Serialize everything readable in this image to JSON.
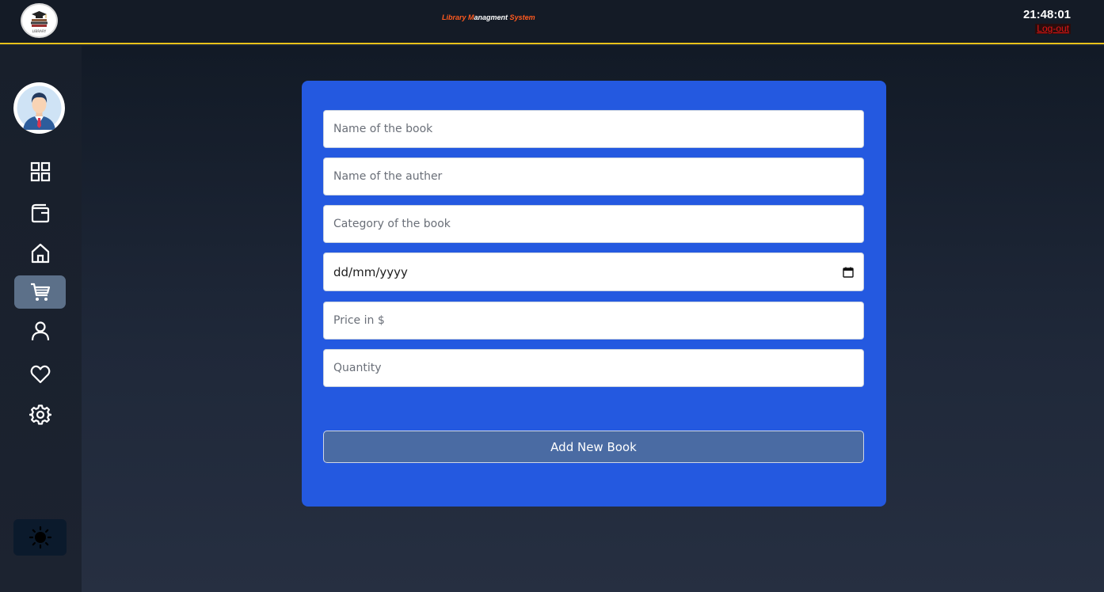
{
  "header": {
    "logo_caption": "LIBRARY",
    "title_parts": [
      "Library M",
      "a",
      "nagment ",
      "S",
      "ystem"
    ],
    "clock": "21:48:01",
    "logout_label": "Log-out"
  },
  "sidebar": {
    "items": [
      {
        "icon": "dashboard-grid-icon",
        "active": false
      },
      {
        "icon": "wallet-icon",
        "active": false
      },
      {
        "icon": "home-icon",
        "active": false
      },
      {
        "icon": "cart-icon",
        "active": true
      },
      {
        "icon": "user-icon",
        "active": false
      },
      {
        "icon": "heart-icon",
        "active": false
      },
      {
        "icon": "gear-icon",
        "active": false
      }
    ],
    "theme_toggle_icon": "sun-icon"
  },
  "form": {
    "book_name_placeholder": "Name of the book",
    "author_placeholder": "Name of the auther",
    "category_placeholder": "Category of the book",
    "date_placeholder": "dd/mm/yyyy",
    "price_placeholder": "Price in $",
    "quantity_placeholder": "Quantity",
    "submit_label": "Add New Book"
  },
  "colors": {
    "card_bg": "#2459e0",
    "header_accent": "#e9c21a",
    "title_orange": "#ff5a1f",
    "logout_red": "#e01515",
    "active_nav": "#5c7089"
  }
}
